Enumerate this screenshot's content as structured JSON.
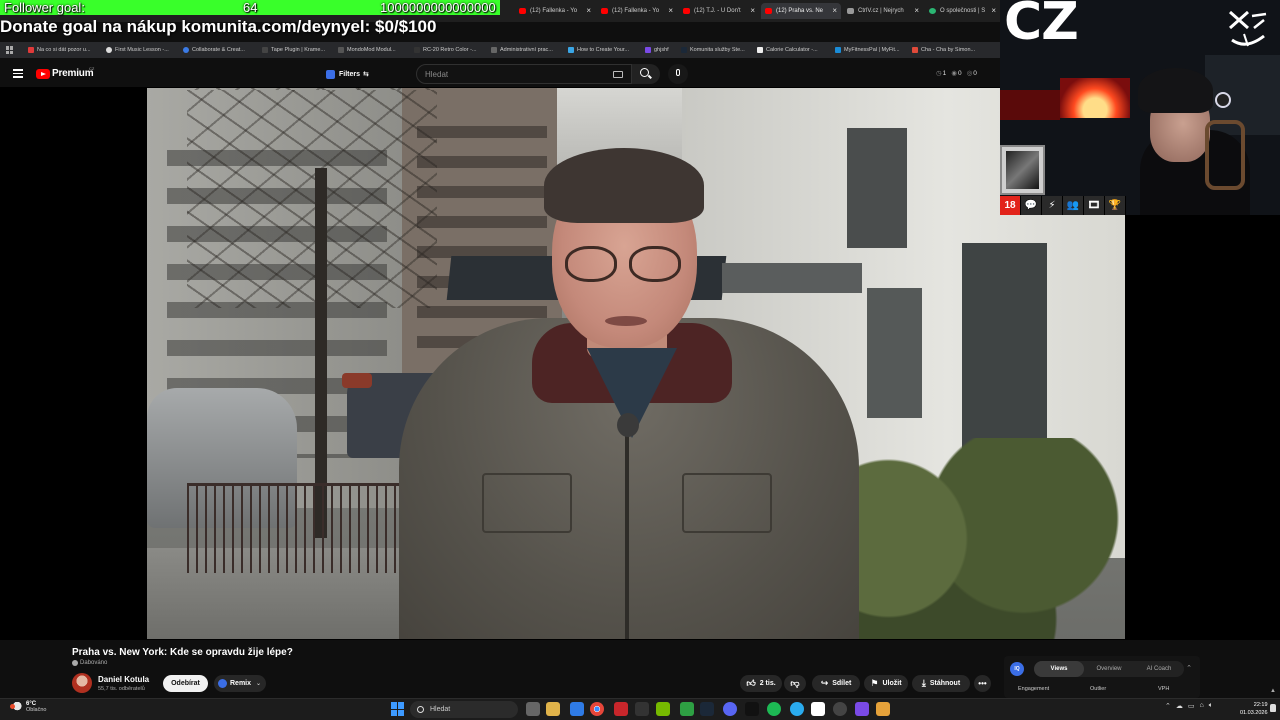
{
  "overlay": {
    "follower_label": "Follower goal:",
    "follower_current": "64",
    "follower_target": "1000000000000000",
    "follower_progress_fraction": 0.0,
    "donate_text": "Donate goal na nákup komunita.com/deynyel: $0/$100",
    "cam_label": "CZ",
    "badges": [
      "18",
      "💬",
      "⚡",
      "👥",
      "🎞",
      "🏆"
    ]
  },
  "browser": {
    "tabs": [
      {
        "label": "(12) Fallenka - Yo",
        "icon": "youtube-icon"
      },
      {
        "label": "(12) Fallenka - Yo",
        "icon": "youtube-icon"
      },
      {
        "label": "(12) T.J. - U Don't",
        "icon": "youtube-icon"
      },
      {
        "label": "(12) Praha vs. Ne",
        "icon": "youtube-icon",
        "active": true
      },
      {
        "label": "CtrlV.cz | Nejrych",
        "icon": "page-icon"
      },
      {
        "label": "O společnosti | S",
        "icon": "globe-icon"
      }
    ],
    "bookmarks": [
      "Na co si dát pozor u...",
      "First Music Lesson -...",
      "Collaborate & Creat...",
      "Tape Plugin | Krame...",
      "MondoMod Modul...",
      "RC-20 Retro Color -...",
      "Administrativní prac...",
      "How to Create Your...",
      "ghjshf",
      "Komunita služby Ste...",
      "Calorie Calculator -...",
      "MyFitnessPal | MyFit...",
      "Cha - Cha by Simon..."
    ]
  },
  "youtube": {
    "logo_text": "Premium",
    "country_code": "CZ",
    "filters_label": "Filters",
    "search_placeholder": "Hledat",
    "header_stats": [
      {
        "icon": "clock-icon",
        "value": "1"
      },
      {
        "icon": "eye-icon",
        "value": "0"
      },
      {
        "icon": "comment-icon",
        "value": "0"
      }
    ],
    "video": {
      "title": "Praha vs. New York: Kde se opravdu žije lépe?",
      "dub_label": "Dabováno",
      "channel_name": "Daniel Kotula",
      "channel_subs": "55,7 tis. odběratelů",
      "subscribe_label": "Odebírat",
      "remix_label": "Remix",
      "like_count": "2 tis.",
      "share_label": "Sdílet",
      "save_label": "Uložit",
      "download_label": "Stáhnout"
    },
    "vidiq": {
      "tabs": [
        "Views",
        "Overview",
        "AI Coach"
      ],
      "metrics": [
        "Engagement",
        "Outlier",
        "VPH"
      ]
    }
  },
  "taskbar": {
    "weather_temp": "6°C",
    "weather_condition": "Oblačno",
    "search_label": "Hledat",
    "time": "22:19",
    "date": "01.03.2026"
  }
}
